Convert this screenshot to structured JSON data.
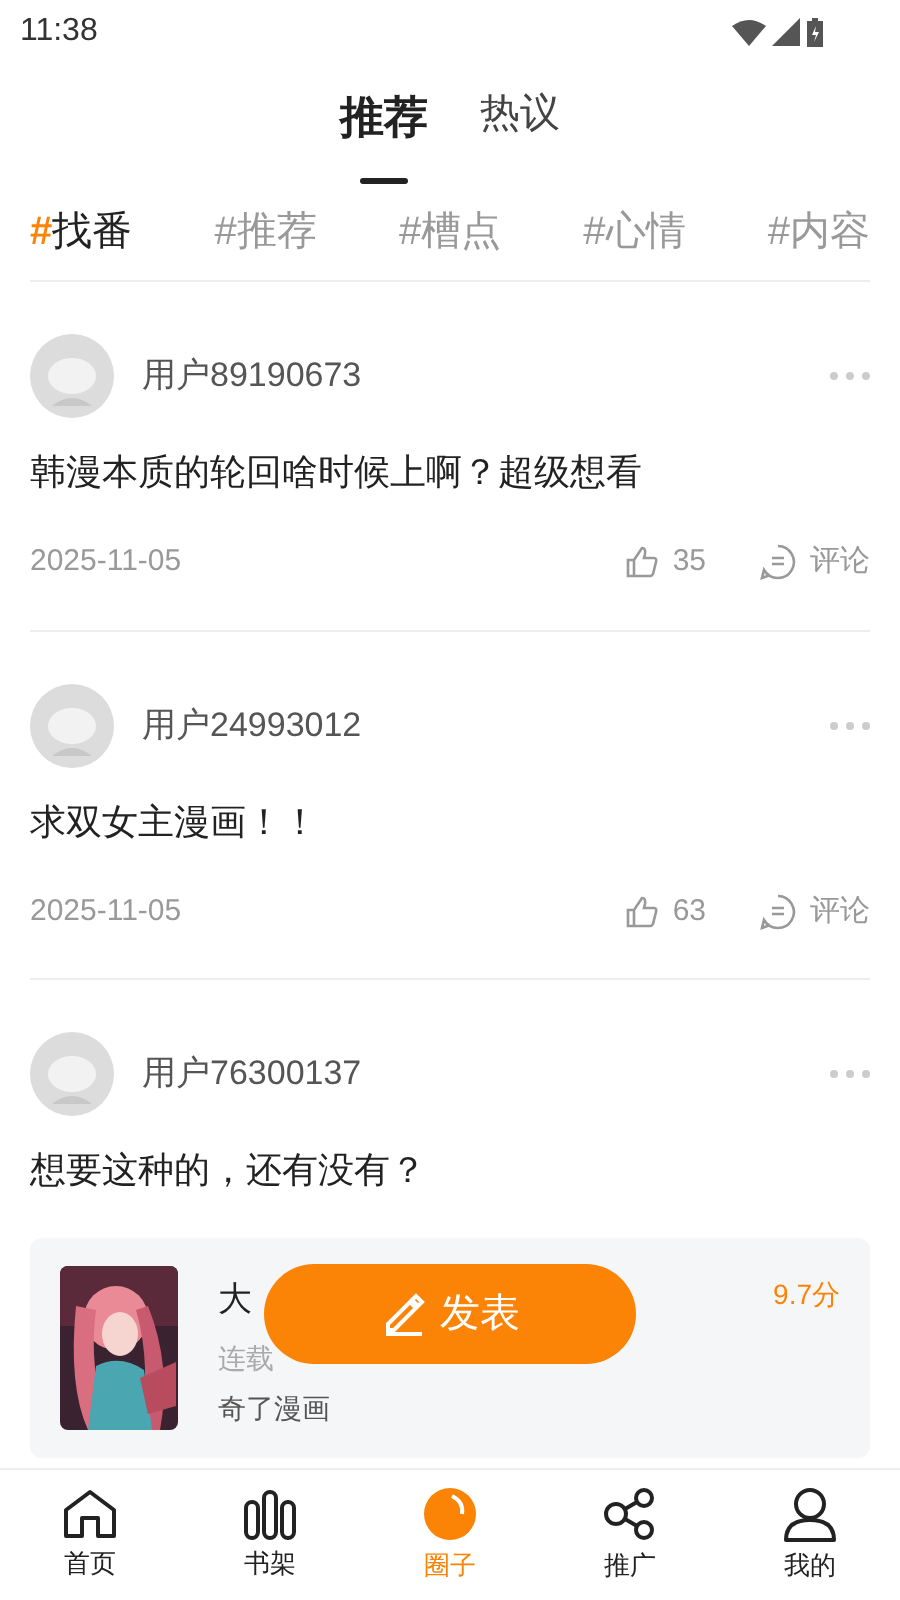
{
  "status_bar": {
    "time": "11:38"
  },
  "tabs": [
    {
      "label": "推荐",
      "selected": true
    },
    {
      "label": "热议",
      "selected": false
    }
  ],
  "topics": [
    {
      "hash": "#",
      "label": "找番",
      "selected": true
    },
    {
      "hash": "#",
      "label": "推荐",
      "selected": false
    },
    {
      "hash": "#",
      "label": "槽点",
      "selected": false
    },
    {
      "hash": "#",
      "label": "心情",
      "selected": false
    },
    {
      "hash": "#",
      "label": "内容",
      "selected": false
    }
  ],
  "posts": [
    {
      "user": "用户89190673",
      "text": "韩漫本质的轮回啥时候上啊？超级想看",
      "date": "2025-11-05",
      "likes": "35",
      "comment": "评论"
    },
    {
      "user": "用户24993012",
      "text": "求双女主漫画！！",
      "date": "2025-11-05",
      "likes": "63",
      "comment": "评论"
    },
    {
      "user": "用户76300137",
      "text": "想要这种的，还有没有？",
      "book": {
        "title": "大",
        "subtitle": "连载",
        "publisher": "奇了漫画",
        "score": "9.7分"
      }
    }
  ],
  "post_button": {
    "label": "发表"
  },
  "nav": [
    {
      "label": "首页",
      "kind": "home",
      "selected": false
    },
    {
      "label": "书架",
      "kind": "shelf",
      "selected": false
    },
    {
      "label": "圈子",
      "kind": "circle",
      "selected": true
    },
    {
      "label": "推广",
      "kind": "share",
      "selected": false
    },
    {
      "label": "我的",
      "kind": "user",
      "selected": false
    }
  ]
}
